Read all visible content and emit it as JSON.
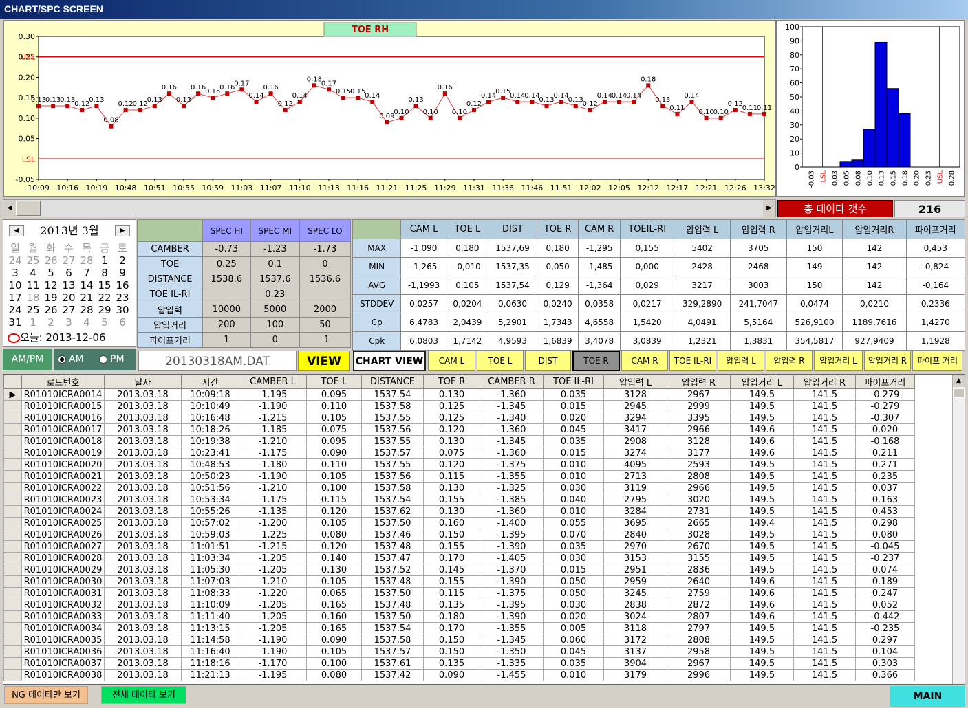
{
  "window": {
    "title": "CHART/SPC SCREEN"
  },
  "chart_data": [
    {
      "type": "line",
      "title": "TOE RH",
      "y_ticks": [
        "0.30",
        "0.25",
        "0.20",
        "0.15",
        "0.10",
        "0.05",
        "-0.05"
      ],
      "usl": 0.25,
      "lsl": 0.0,
      "usl_label": "USL",
      "lsl_label": "LSL",
      "ylim": [
        -0.05,
        0.3
      ],
      "x_ticks": [
        "10:09",
        "10:16",
        "10:19",
        "10:48",
        "10:51",
        "10:55",
        "10:59",
        "11:03",
        "11:07",
        "11:10",
        "11:13",
        "11:16",
        "11:21",
        "11:25",
        "11:29",
        "11:31",
        "11:36",
        "11:46",
        "11:51",
        "12:02",
        "12:05",
        "12:12",
        "12:17",
        "12:21",
        "12:26",
        "13:32"
      ],
      "values": [
        0.13,
        0.13,
        0.13,
        0.12,
        0.13,
        0.08,
        0.12,
        0.12,
        0.13,
        0.16,
        0.13,
        0.16,
        0.15,
        0.16,
        0.17,
        0.14,
        0.16,
        0.12,
        0.14,
        0.18,
        0.17,
        0.15,
        0.15,
        0.14,
        0.09,
        0.1,
        0.13,
        0.1,
        0.16,
        0.1,
        0.12,
        0.14,
        0.15,
        0.14,
        0.14,
        0.13,
        0.14,
        0.13,
        0.12,
        0.14,
        0.14,
        0.14,
        0.18,
        0.13,
        0.11,
        0.14,
        0.1,
        0.1,
        0.12,
        0.11,
        0.11
      ]
    },
    {
      "type": "bar",
      "title": "",
      "y_ticks": [
        "100",
        "90",
        "80",
        "70",
        "60",
        "50",
        "40",
        "30",
        "20",
        "10",
        "0"
      ],
      "ylim": [
        0,
        100
      ],
      "categories": [
        "-0.03",
        "LSL",
        "0.03",
        "0.05",
        "0.08",
        "0.10",
        "0.13",
        "0.15",
        "0.18",
        "0.20",
        "0.23",
        "USL",
        "0.28"
      ],
      "values": [
        0,
        0,
        0,
        4,
        5,
        27,
        89,
        56,
        38,
        0,
        0,
        0,
        0
      ]
    }
  ],
  "summary": {
    "total_label": "총 데이타 갯수",
    "total_value": "216"
  },
  "calendar": {
    "title": "2013년 3월",
    "prev": "◀",
    "next": "▶",
    "weekdays": [
      "일",
      "월",
      "화",
      "수",
      "목",
      "금",
      "토"
    ],
    "days": [
      "24",
      "25",
      "26",
      "27",
      "28",
      "1",
      "2",
      "3",
      "4",
      "5",
      "6",
      "7",
      "8",
      "9",
      "10",
      "11",
      "12",
      "13",
      "14",
      "15",
      "16",
      "17",
      "18",
      "19",
      "20",
      "21",
      "22",
      "23",
      "24",
      "25",
      "26",
      "27",
      "28",
      "29",
      "30",
      "31",
      "1",
      "2",
      "3",
      "4",
      "5",
      "6"
    ],
    "today": "오늘: 2013-12-06"
  },
  "spec": {
    "headers": [
      "SPEC HI",
      "SPEC MI",
      "SPEC LO"
    ],
    "rows": [
      [
        "CAMBER",
        "-0.73",
        "-1.23",
        "-1.73"
      ],
      [
        "TOE",
        "0.25",
        "0.1",
        "0"
      ],
      [
        "DISTANCE",
        "1538.6",
        "1537.6",
        "1536.6"
      ],
      [
        "TOE IL-RI",
        "",
        "0.23",
        ""
      ],
      [
        "압입력",
        "10000",
        "5000",
        "2000"
      ],
      [
        "압입거리",
        "200",
        "100",
        "50"
      ],
      [
        "파이프거리",
        "1",
        "0",
        "-1"
      ]
    ]
  },
  "stats": {
    "headers": [
      "CAM L",
      "TOE L",
      "DIST",
      "TOE R",
      "CAM R",
      "TOEIL-RI",
      "압입력 L",
      "압입력 R",
      "압입거리L",
      "압입거리R",
      "파이프거리"
    ],
    "rows": [
      [
        "MAX",
        "-1,090",
        "0,180",
        "1537,69",
        "0,180",
        "-1,295",
        "0,155",
        "5402",
        "3705",
        "150",
        "142",
        "0,453"
      ],
      [
        "MIN",
        "-1,265",
        "-0,010",
        "1537,35",
        "0,050",
        "-1,485",
        "0,000",
        "2428",
        "2468",
        "149",
        "142",
        "-0,824"
      ],
      [
        "AVG",
        "-1,1993",
        "0,105",
        "1537,54",
        "0,129",
        "-1,364",
        "0,029",
        "3217",
        "3003",
        "150",
        "142",
        "-0,164"
      ],
      [
        "STDDEV",
        "0,0257",
        "0,0204",
        "0,0630",
        "0,0240",
        "0,0358",
        "0,0217",
        "329,2890",
        "241,7047",
        "0,0474",
        "0,0210",
        "0,2336"
      ],
      [
        "Cp",
        "6,4783",
        "2,0439",
        "5,2901",
        "1,7343",
        "4,6558",
        "1,5420",
        "4,0491",
        "5,5164",
        "526,9100",
        "1189,7616",
        "1,4270"
      ],
      [
        "Cpk",
        "6,0803",
        "1,7142",
        "4,9593",
        "1,6839",
        "3,4078",
        "3,0839",
        "1,2321",
        "1,3831",
        "354,5817",
        "927,9409",
        "1,1928"
      ]
    ]
  },
  "controls": {
    "ampm": "AM/PM",
    "am": "AM",
    "pm": "PM",
    "file": "20130318AM.DAT",
    "view": "VIEW",
    "chart_view": "CHART VIEW",
    "select_buttons": [
      "CAM L",
      "TOE L",
      "DIST",
      "TOE R",
      "CAM R",
      "TOE IL-RI",
      "압입력 L",
      "압입력 R",
      "압입거리 L",
      "압입거리 R",
      "파이프 거리"
    ]
  },
  "table": {
    "headers": [
      "로드번호",
      "날자",
      "시간",
      "CAMBER L",
      "TOE L",
      "DISTANCE",
      "TOE R",
      "CAMBER R",
      "TOE IL-RI",
      "압입력 L",
      "압입력 R",
      "압입거리 L",
      "압입거리 R",
      "파이프거리"
    ],
    "rows": [
      [
        "R01010ICRA0014",
        "2013.03.18",
        "10:09:18",
        "-1.195",
        "0.095",
        "1537.54",
        "0.130",
        "-1.360",
        "0.035",
        "3128",
        "2967",
        "149.5",
        "141.5",
        "-0.279"
      ],
      [
        "R01010ICRA0015",
        "2013.03.18",
        "10:10:49",
        "-1.190",
        "0.110",
        "1537.58",
        "0.125",
        "-1.345",
        "0.015",
        "2945",
        "2999",
        "149.5",
        "141.5",
        "-0.279"
      ],
      [
        "R01010ICRA0016",
        "2013.03.18",
        "10:16:48",
        "-1.215",
        "0.105",
        "1537.55",
        "0.125",
        "-1.340",
        "0.020",
        "3294",
        "3395",
        "149.5",
        "141.5",
        "-0.307"
      ],
      [
        "R01010ICRA0017",
        "2013.03.18",
        "10:18:26",
        "-1.185",
        "0.075",
        "1537.56",
        "0.120",
        "-1.360",
        "0.045",
        "3417",
        "2966",
        "149.6",
        "141.5",
        "0.020"
      ],
      [
        "R01010ICRA0018",
        "2013.03.18",
        "10:19:38",
        "-1.210",
        "0.095",
        "1537.55",
        "0.130",
        "-1.345",
        "0.035",
        "2908",
        "3128",
        "149.6",
        "141.5",
        "-0.168"
      ],
      [
        "R01010ICRA0019",
        "2013.03.18",
        "10:23:41",
        "-1.175",
        "0.090",
        "1537.57",
        "0.075",
        "-1.360",
        "0.015",
        "3274",
        "3177",
        "149.6",
        "141.5",
        "0.211"
      ],
      [
        "R01010ICRA0020",
        "2013.03.18",
        "10:48:53",
        "-1.180",
        "0.110",
        "1537.55",
        "0.120",
        "-1.375",
        "0.010",
        "4095",
        "2593",
        "149.5",
        "141.5",
        "0.271"
      ],
      [
        "R01010ICRA0021",
        "2013.03.18",
        "10:50:23",
        "-1.190",
        "0.105",
        "1537.56",
        "0.115",
        "-1.355",
        "0.010",
        "2713",
        "2808",
        "149.5",
        "141.5",
        "0.235"
      ],
      [
        "R01010ICRA0022",
        "2013.03.18",
        "10:51:56",
        "-1.210",
        "0.100",
        "1537.58",
        "0.130",
        "-1.325",
        "0.030",
        "3119",
        "2966",
        "149.5",
        "141.5",
        "0.037"
      ],
      [
        "R01010ICRA0023",
        "2013.03.18",
        "10:53:34",
        "-1.175",
        "0.115",
        "1537.54",
        "0.155",
        "-1.385",
        "0.040",
        "2795",
        "3020",
        "149.5",
        "141.5",
        "0.163"
      ],
      [
        "R01010ICRA0024",
        "2013.03.18",
        "10:55:26",
        "-1.135",
        "0.120",
        "1537.62",
        "0.130",
        "-1.360",
        "0.010",
        "3284",
        "2731",
        "149.5",
        "141.5",
        "0.453"
      ],
      [
        "R01010ICRA0025",
        "2013.03.18",
        "10:57:02",
        "-1.200",
        "0.105",
        "1537.50",
        "0.160",
        "-1.400",
        "0.055",
        "3695",
        "2665",
        "149.4",
        "141.5",
        "0.298"
      ],
      [
        "R01010ICRA0026",
        "2013.03.18",
        "10:59:03",
        "-1.225",
        "0.080",
        "1537.46",
        "0.150",
        "-1.395",
        "0.070",
        "2840",
        "3028",
        "149.5",
        "141.5",
        "0.080"
      ],
      [
        "R01010ICRA0027",
        "2013.03.18",
        "11:01:51",
        "-1.215",
        "0.120",
        "1537.48",
        "0.155",
        "-1.390",
        "0.035",
        "2970",
        "2670",
        "149.5",
        "141.5",
        "-0.045"
      ],
      [
        "R01010ICRA0028",
        "2013.03.18",
        "11:03:34",
        "-1.205",
        "0.140",
        "1537.47",
        "0.170",
        "-1.405",
        "0.030",
        "3153",
        "3155",
        "149.5",
        "141.5",
        "-0.237"
      ],
      [
        "R01010ICRA0029",
        "2013.03.18",
        "11:05:30",
        "-1.205",
        "0.130",
        "1537.52",
        "0.145",
        "-1.370",
        "0.015",
        "2951",
        "2836",
        "149.5",
        "141.5",
        "0.074"
      ],
      [
        "R01010ICRA0030",
        "2013.03.18",
        "11:07:03",
        "-1.210",
        "0.105",
        "1537.48",
        "0.155",
        "-1.390",
        "0.050",
        "2959",
        "2640",
        "149.6",
        "141.5",
        "0.189"
      ],
      [
        "R01010ICRA0031",
        "2013.03.18",
        "11:08:33",
        "-1.220",
        "0.065",
        "1537.50",
        "0.115",
        "-1.375",
        "0.050",
        "3245",
        "2759",
        "149.6",
        "141.5",
        "0.247"
      ],
      [
        "R01010ICRA0032",
        "2013.03.18",
        "11:10:09",
        "-1.205",
        "0.165",
        "1537.48",
        "0.135",
        "-1.395",
        "0.030",
        "2838",
        "2872",
        "149.6",
        "141.5",
        "0.052"
      ],
      [
        "R01010ICRA0033",
        "2013.03.18",
        "11:11:40",
        "-1.205",
        "0.160",
        "1537.50",
        "0.180",
        "-1.390",
        "0.020",
        "3024",
        "2807",
        "149.6",
        "141.5",
        "-0.442"
      ],
      [
        "R01010ICRA0034",
        "2013.03.18",
        "11:13:15",
        "-1.205",
        "0.165",
        "1537.54",
        "0.170",
        "-1.355",
        "0.005",
        "3118",
        "2797",
        "149.5",
        "141.5",
        "-0.235"
      ],
      [
        "R01010ICRA0035",
        "2013.03.18",
        "11:14:58",
        "-1.190",
        "0.090",
        "1537.58",
        "0.150",
        "-1.345",
        "0.060",
        "3172",
        "2808",
        "149.5",
        "141.5",
        "0.297"
      ],
      [
        "R01010ICRA0036",
        "2013.03.18",
        "11:16:40",
        "-1.190",
        "0.105",
        "1537.57",
        "0.150",
        "-1.350",
        "0.045",
        "3137",
        "2958",
        "149.5",
        "141.5",
        "0.104"
      ],
      [
        "R01010ICRA0037",
        "2013.03.18",
        "11:18:16",
        "-1.170",
        "0.100",
        "1537.61",
        "0.135",
        "-1.335",
        "0.035",
        "3904",
        "2967",
        "149.5",
        "141.5",
        "0.303"
      ],
      [
        "R01010ICRA0038",
        "2013.03.18",
        "11:21:13",
        "-1.195",
        "0.080",
        "1537.42",
        "0.090",
        "-1.455",
        "0.010",
        "3179",
        "2996",
        "149.5",
        "141.5",
        "0.366"
      ]
    ]
  },
  "footer": {
    "ng": "NG 데이타만 보기",
    "all": "전체 데이타 보기",
    "main": "MAIN"
  }
}
